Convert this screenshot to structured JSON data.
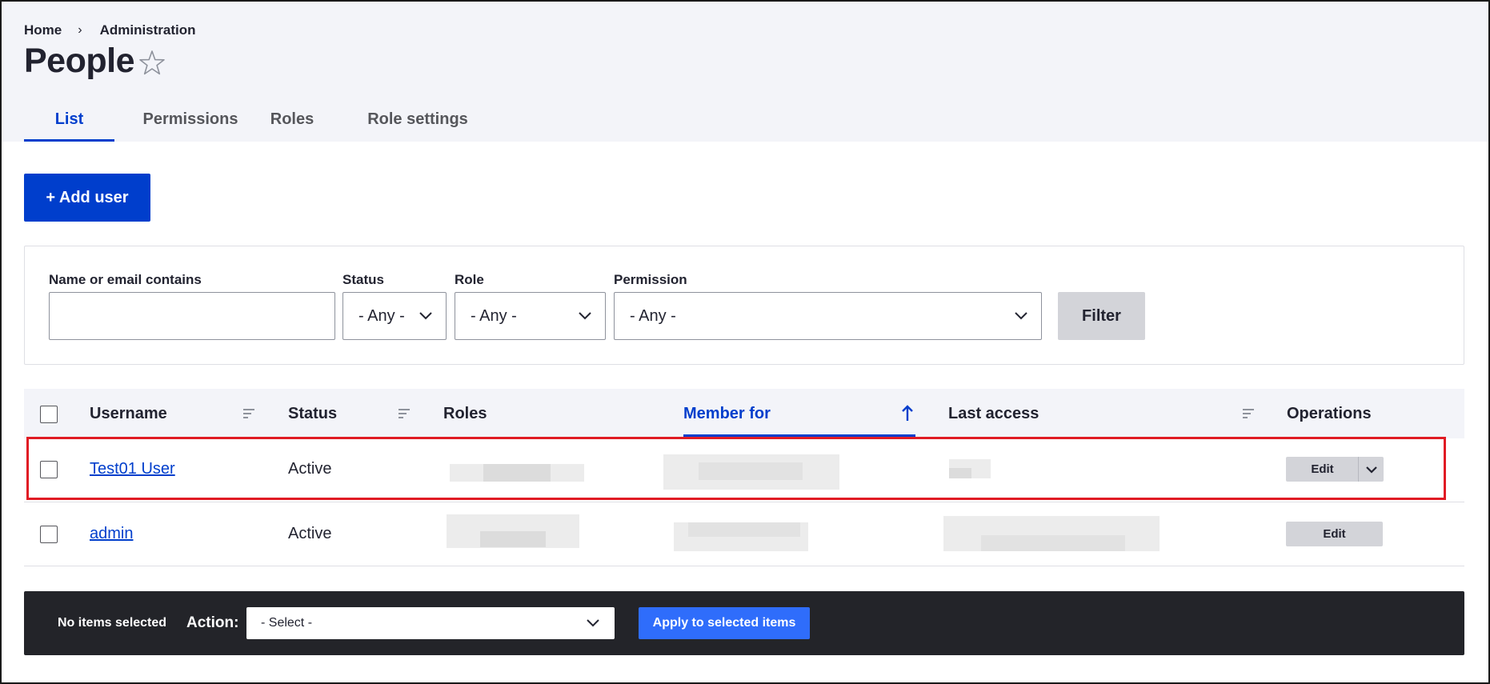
{
  "breadcrumb": {
    "home": "Home",
    "separator": "›",
    "admin": "Administration"
  },
  "page": {
    "title": "People",
    "favorite_icon": "star-outline-icon"
  },
  "tabs": [
    {
      "label": "List",
      "active": true
    },
    {
      "label": "Permissions",
      "active": false
    },
    {
      "label": "Roles",
      "active": false
    },
    {
      "label": "Role settings",
      "active": false
    }
  ],
  "add_user_label": "+ Add user",
  "filters": {
    "name_label": "Name or email contains",
    "name_value": "",
    "status_label": "Status",
    "status_value": "- Any -",
    "role_label": "Role",
    "role_value": "- Any -",
    "permission_label": "Permission",
    "permission_value": "- Any -",
    "filter_button": "Filter"
  },
  "table": {
    "headers": {
      "username": "Username",
      "status": "Status",
      "roles": "Roles",
      "member_for": "Member for",
      "last_access": "Last access",
      "operations": "Operations"
    },
    "sorted_column": "member_for",
    "rows": [
      {
        "username": "Test01 User",
        "status": "Active",
        "edit": "Edit",
        "has_dropdown": true,
        "highlighted": true
      },
      {
        "username": "admin",
        "status": "Active",
        "edit": "Edit",
        "has_dropdown": false,
        "highlighted": false
      }
    ]
  },
  "bulk": {
    "status": "No items selected",
    "action_label": "Action:",
    "select_value": "- Select -",
    "apply_label": "Apply to selected items"
  },
  "colors": {
    "accent": "#003ecc",
    "highlight": "#e01b24",
    "bulk_bar": "#232429",
    "apply": "#2f6dfb"
  }
}
